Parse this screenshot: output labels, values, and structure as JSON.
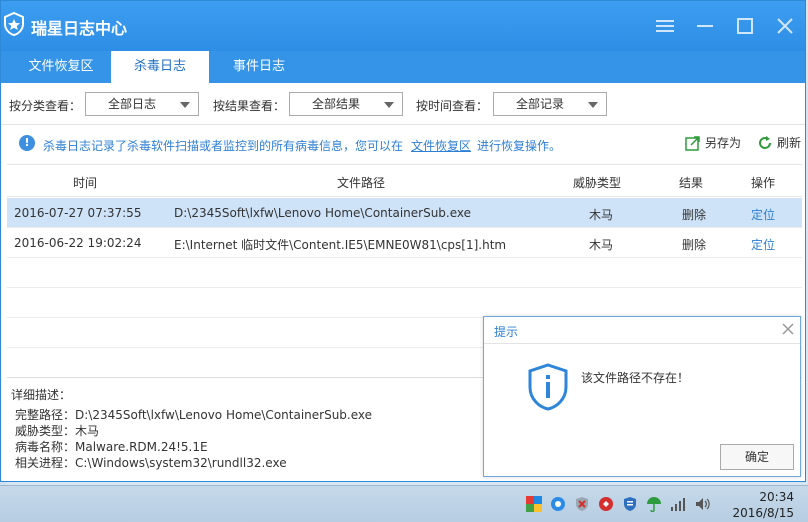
{
  "app": {
    "title": "瑞星日志中心"
  },
  "tabs": [
    {
      "label": "文件恢复区",
      "active": false
    },
    {
      "label": "杀毒日志",
      "active": true
    },
    {
      "label": "事件日志",
      "active": false
    }
  ],
  "filters": {
    "category": {
      "label": "按分类查看：",
      "value": "全部日志"
    },
    "result": {
      "label": "按结果查看：",
      "value": "全部结果"
    },
    "time": {
      "label": "按时间查看：",
      "value": "全部记录"
    }
  },
  "info": {
    "text_before": "杀毒日志记录了杀毒软件扫描或者监控到的所有病毒信息，您可以在",
    "link": "文件恢复区",
    "text_after": "进行恢复操作。"
  },
  "actions": {
    "save_as": "另存为",
    "refresh": "刷新"
  },
  "table": {
    "columns": [
      "时间",
      "文件路径",
      "威胁类型",
      "结果",
      "操作"
    ],
    "rows": [
      {
        "time": "2016-07-27 07:37:55",
        "path": "D:\\2345Soft\\lxfw\\Lenovo Home\\ContainerSub.exe",
        "threat": "木马",
        "result": "删除",
        "action": "定位"
      },
      {
        "time": "2016-06-22 19:02:24",
        "path": "E:\\Internet 临时文件\\Content.IE5\\EMNE0W81\\cps[1].htm",
        "threat": "木马",
        "result": "删除",
        "action": "定位"
      }
    ]
  },
  "detail": {
    "heading": "详细描述：",
    "full_path": "完整路径：D:\\2345Soft\\lxfw\\Lenovo Home\\ContainerSub.exe",
    "threat_type": "威胁类型：木马",
    "virus_name": "病毒名称：Malware.RDM.24!5.1E",
    "process": "相关进程：C:\\Windows\\system32\\rundll32.exe"
  },
  "dialog": {
    "title": "提示",
    "message": "该文件路径不存在！",
    "ok": "确定"
  },
  "taskbar": {
    "time": "20:34",
    "date": "2016/8/15"
  },
  "colors": {
    "accent": "#2e8ee6",
    "link": "#2e7fd6",
    "selected_row": "#cfe3f8"
  }
}
